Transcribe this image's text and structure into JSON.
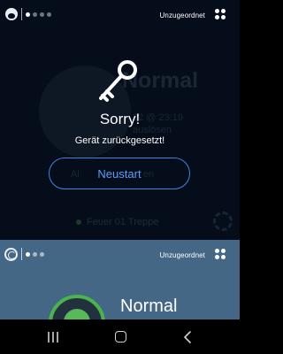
{
  "top_panel": {
    "pager": {
      "total": 4,
      "active_index": 0
    },
    "group_label": "Unzugeordnet",
    "background_device": {
      "status": "Normal",
      "time_partial": "22 @ 23:19",
      "action_partial": "auslösen",
      "button_partial": "Al",
      "button_partial_end": "en",
      "location": "Feuer 01 Treppe"
    },
    "overlay": {
      "icon": "key-icon",
      "title": "Sorry!",
      "message": "Gerät zurückgesetzt!",
      "restart_button": "Neustart"
    }
  },
  "bottom_panel": {
    "pager": {
      "total": 3,
      "active_index": 0
    },
    "group_label": "Unzugeordnet",
    "device": {
      "status": "Normal"
    }
  },
  "navbar": {
    "recent_icon": "recent-apps-icon",
    "home_icon": "home-icon",
    "back_icon": "back-icon"
  },
  "colors": {
    "top_bg": "#050d1a",
    "bottom_bg": "#456786",
    "accent_blue": "#3f82e6",
    "ok_green": "#4bb34c"
  }
}
